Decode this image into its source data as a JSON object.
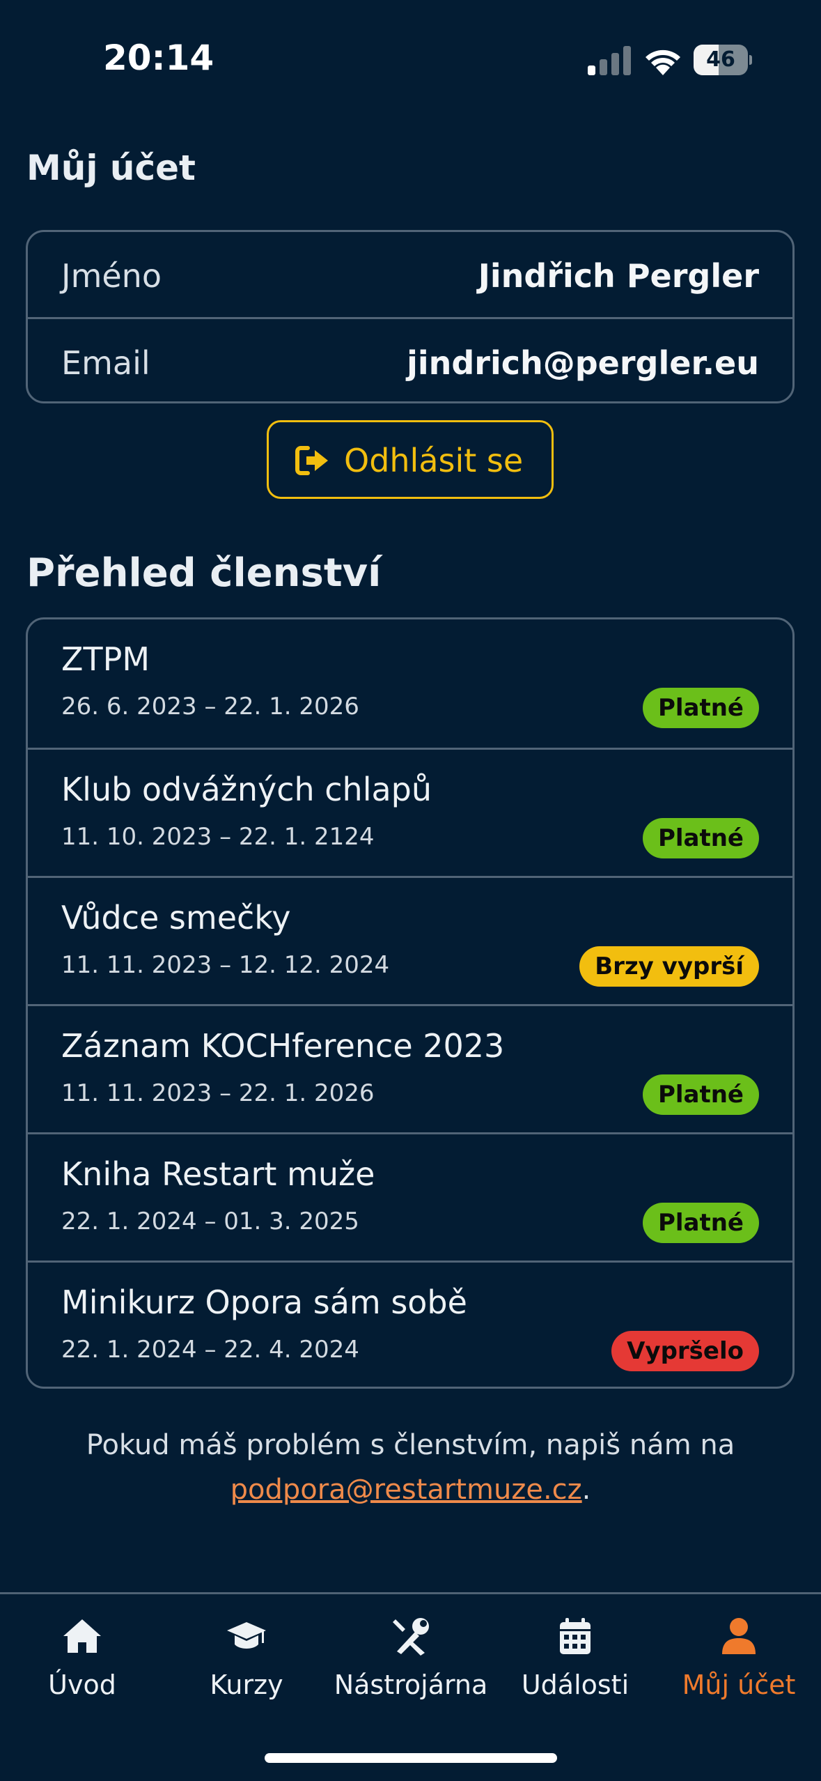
{
  "status": {
    "time": "20:14",
    "battery_level": 46,
    "battery_text": "46",
    "icons": [
      "cellular-signal-icon",
      "wifi-icon",
      "battery-icon"
    ]
  },
  "account": {
    "title": "Můj účet",
    "name_label": "Jméno",
    "name_value": "Jindřich Pergler",
    "email_label": "Email",
    "email_value": "jindrich@pergler.eu",
    "logout_label": "Odhlásit se"
  },
  "membership": {
    "title": "Přehled členství",
    "items": [
      {
        "name": "ZTPM",
        "dates": "26. 6. 2023 – 22. 1. 2026",
        "status": "Platné"
      },
      {
        "name": "Klub odvážných chlapů",
        "dates": "11. 10. 2023 – 22. 1. 2124",
        "status": "Platné"
      },
      {
        "name": "Vůdce smečky",
        "dates": "11. 11. 2023 – 12. 12. 2024",
        "status": "Brzy vyprší"
      },
      {
        "name": "Záznam KOCHference 2023",
        "dates": "11. 11. 2023 – 22. 1. 2026",
        "status": "Platné"
      },
      {
        "name": "Kniha Restart muže",
        "dates": "22. 1. 2024 – 01. 3. 2025",
        "status": "Platné"
      },
      {
        "name": "Minikurz Opora sám sobě",
        "dates": "22. 1. 2024 – 22. 4. 2024",
        "status": "Vypršelo"
      }
    ]
  },
  "help": {
    "text": "Pokud máš problém s členstvím, napiš nám na",
    "email": "podpora@restartmuze.cz",
    "suffix": "."
  },
  "tabs": [
    {
      "label": "Úvod",
      "icon": "home-icon"
    },
    {
      "label": "Kurzy",
      "icon": "graduation-cap-icon"
    },
    {
      "label": "Nástrojárna",
      "icon": "tools-icon"
    },
    {
      "label": "Události",
      "icon": "calendar-icon"
    },
    {
      "label": "Můj účet",
      "icon": "user-icon"
    }
  ],
  "active_tab": 4,
  "colors": {
    "background": "#031c33",
    "accent": "#ef7a2c",
    "logout": "#f2be0f",
    "valid": "#6bbf1a",
    "expiring": "#f2be0f",
    "expired": "#e53935"
  }
}
